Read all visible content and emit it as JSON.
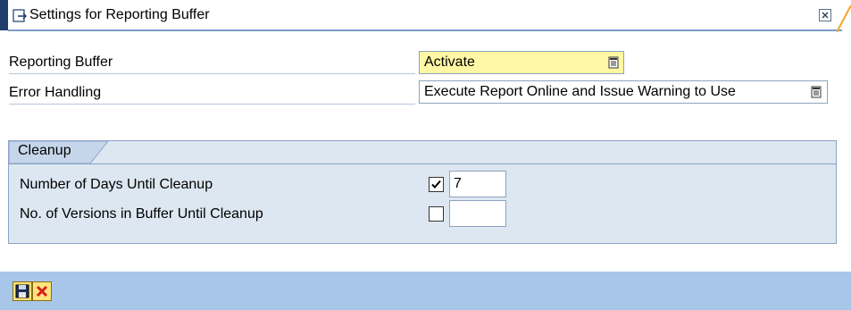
{
  "window": {
    "title": "Settings for Reporting Buffer",
    "close_icon": "close-icon"
  },
  "fields": {
    "reporting_buffer": {
      "label": "Reporting Buffer",
      "value": "Activate"
    },
    "error_handling": {
      "label": "Error Handling",
      "value": "Execute Report Online and Issue Warning to Use"
    }
  },
  "cleanup": {
    "title": "Cleanup",
    "days": {
      "label": "Number of Days Until Cleanup",
      "checked": true,
      "value": "7"
    },
    "versions": {
      "label": "No. of Versions in Buffer Until Cleanup",
      "checked": false,
      "value": ""
    }
  },
  "toolbar": {
    "save_icon": "save-icon",
    "cancel_icon": "cancel-icon"
  },
  "colors": {
    "highlight": "#fff7a3",
    "group_bg": "#dde7f1",
    "toolbar_bg": "#a8c6e8",
    "accent": "#f5a623"
  }
}
